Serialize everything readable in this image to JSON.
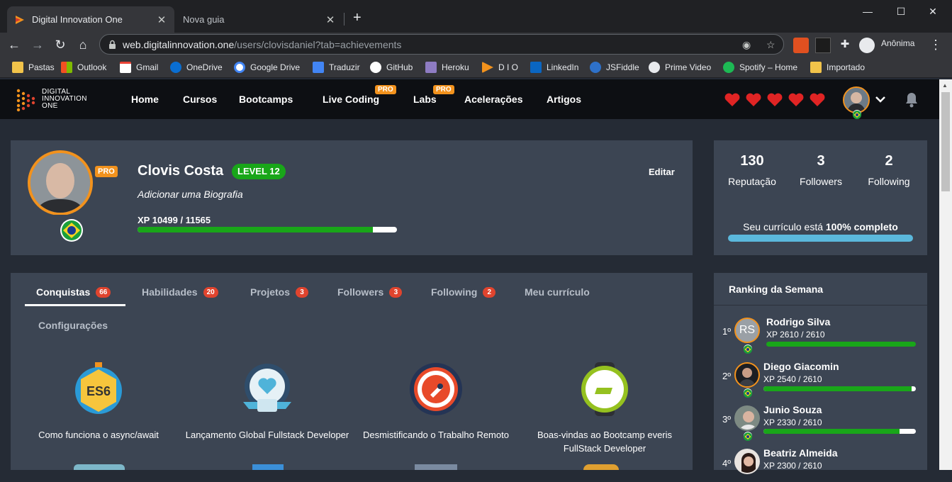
{
  "browser": {
    "tabs": [
      {
        "title": "Digital Innovation One",
        "active": true
      },
      {
        "title": "Nova guia",
        "active": false
      }
    ],
    "url_host": "web.digitalinnovation.one",
    "url_path": "/users/clovisdaniel?tab=achievements",
    "profile_label": "Anônima",
    "bookmarks": [
      "Pastas",
      "Outlook",
      "Gmail",
      "OneDrive",
      "Google Drive",
      "Traduzir",
      "GitHub",
      "Heroku",
      "D I O",
      "LinkedIn",
      "JSFiddle",
      "Prime Video",
      "Spotify – Home",
      "Importado"
    ]
  },
  "site": {
    "logo": [
      "DIGITAL",
      "INNOVATION",
      "ONE"
    ],
    "nav": [
      "Home",
      "Cursos",
      "Bootcamps",
      "Live Coding",
      "Labs",
      "Acelerações",
      "Artigos"
    ],
    "pro_label": "PRO",
    "hearts": 5
  },
  "profile": {
    "name": "Clovis Costa",
    "level": "LEVEL 12",
    "pro_label": "PRO",
    "bio_placeholder": "Adicionar uma Biografia",
    "xp_label": "XP 10499 / 11565",
    "xp_fraction": 0.908,
    "edit_label": "Editar"
  },
  "stats": [
    {
      "value": "130",
      "label": "Reputação"
    },
    {
      "value": "3",
      "label": "Followers"
    },
    {
      "value": "2",
      "label": "Following"
    }
  ],
  "curriculum": {
    "prefix": "Seu currículo está ",
    "bold": "100% completo",
    "fraction": 1.0
  },
  "profile_tabs": [
    {
      "label": "Conquistas",
      "count": "66"
    },
    {
      "label": "Habilidades",
      "count": "20"
    },
    {
      "label": "Projetos",
      "count": "3"
    },
    {
      "label": "Followers",
      "count": "3"
    },
    {
      "label": "Following",
      "count": "2"
    },
    {
      "label": "Meu currículo",
      "count": null
    },
    {
      "label": "Configurações",
      "count": null
    }
  ],
  "achievements": [
    {
      "title": "Como funciona o async/await",
      "icon": "es6-badge-icon"
    },
    {
      "title": "Lançamento Global Fullstack Developer",
      "icon": "heart-trophy-badge-icon"
    },
    {
      "title": "Desmistificando o Trabalho Remoto",
      "icon": "rocket-badge-icon"
    },
    {
      "title": "Boas-vindas ao Bootcamp everis FullStack Developer",
      "icon": "everis-watch-badge-icon"
    }
  ],
  "ranking": {
    "title": "Ranking da Semana",
    "entries": [
      {
        "pos": "1º",
        "name": "Rodrigo Silva",
        "initials": "RS",
        "xp": "XP 2610 / 2610",
        "fraction": 1.0
      },
      {
        "pos": "2º",
        "name": "Diego Giacomin",
        "xp": "XP 2540 / 2610",
        "fraction": 0.973
      },
      {
        "pos": "3º",
        "name": "Junio Souza",
        "xp": "XP 2330 / 2610",
        "fraction": 0.893
      },
      {
        "pos": "4º",
        "name": "Beatriz Almeida",
        "xp": "XP 2300 / 2610",
        "fraction": 0.881
      }
    ]
  },
  "colors": {
    "accent": "#f2921d",
    "green": "#19a619",
    "badge_red": "#e0442e",
    "card": "#3c4553",
    "page": "#252b35"
  }
}
